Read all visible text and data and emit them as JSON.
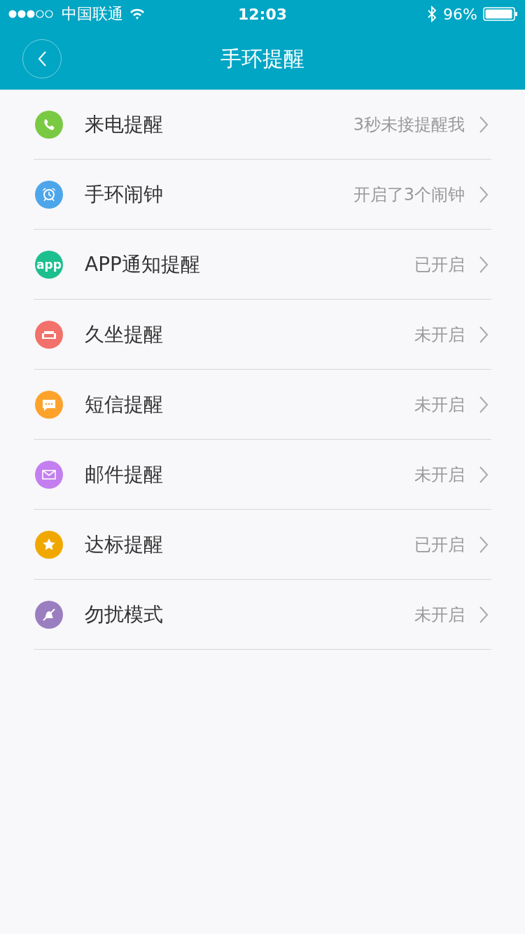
{
  "status_bar": {
    "carrier": "中国联通",
    "time": "12:03",
    "battery": "96%"
  },
  "nav": {
    "title": "手环提醒"
  },
  "items": [
    {
      "kind": "phone",
      "color": "#7ac943",
      "label": "来电提醒",
      "value": "3秒未接提醒我"
    },
    {
      "kind": "alarm",
      "color": "#4da6ea",
      "label": "手环闹钟",
      "value": "开启了3个闹钟"
    },
    {
      "kind": "app",
      "color": "#1dbf8e",
      "icon_text": "app",
      "label": "APP通知提醒",
      "value": "已开启"
    },
    {
      "kind": "sofa",
      "color": "#f2716a",
      "label": "久坐提醒",
      "value": "未开启"
    },
    {
      "kind": "message",
      "color": "#fda32c",
      "label": "短信提醒",
      "value": "未开启"
    },
    {
      "kind": "mail",
      "color": "#c37ff0",
      "label": "邮件提醒",
      "value": "未开启"
    },
    {
      "kind": "star",
      "color": "#f0a800",
      "label": "达标提醒",
      "value": "已开启"
    },
    {
      "kind": "mute",
      "color": "#9b7ec0",
      "label": "勿扰模式",
      "value": "未开启"
    }
  ]
}
